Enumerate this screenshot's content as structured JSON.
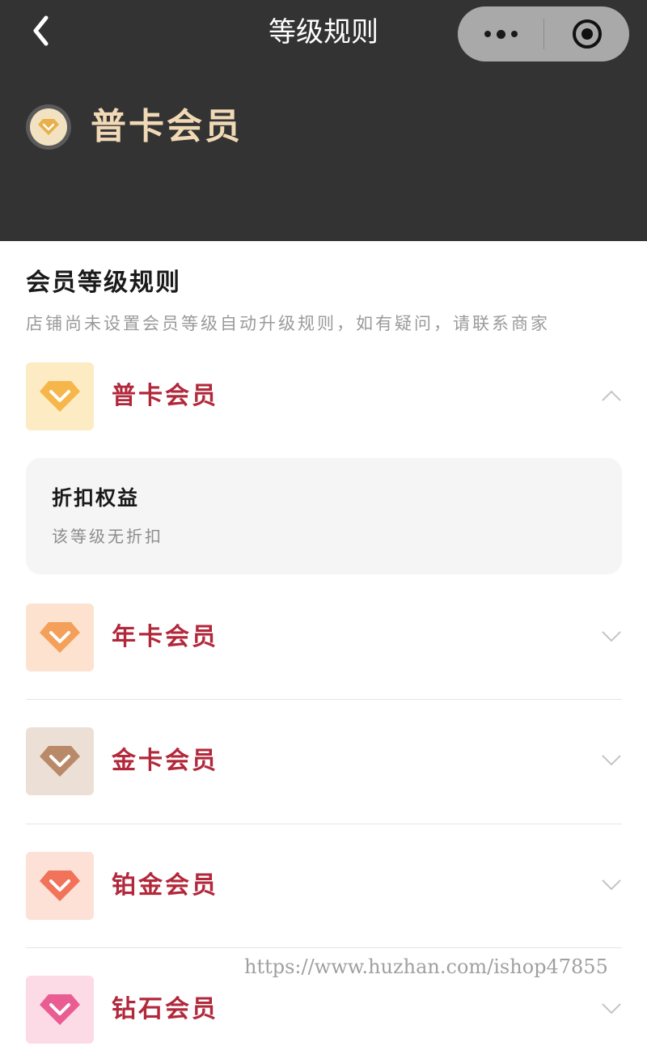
{
  "nav": {
    "title": "等级规则"
  },
  "current": {
    "level_name": "普卡会员"
  },
  "section": {
    "title": "会员等级规则",
    "description": "店铺尚未设置会员等级自动升级规则，如有疑问，请联系商家"
  },
  "levels": [
    {
      "name": "普卡会员",
      "expanded": true,
      "tile_color": "#fdebc4",
      "gem_color": "#f6b64a"
    },
    {
      "name": "年卡会员",
      "expanded": false,
      "tile_color": "#fde3cf",
      "gem_color": "#f4a05a"
    },
    {
      "name": "金卡会员",
      "expanded": false,
      "tile_color": "#ece0d6",
      "gem_color": "#b98a69"
    },
    {
      "name": "铂金会员",
      "expanded": false,
      "tile_color": "#fde0d6",
      "gem_color": "#f0735a"
    },
    {
      "name": "钻石会员",
      "expanded": false,
      "tile_color": "#fcdbe6",
      "gem_color": "#ea5d92"
    }
  ],
  "benefit": {
    "title": "折扣权益",
    "description": "该等级无折扣"
  },
  "watermark": "https://www.huzhan.com/ishop47855",
  "colors": {
    "header_bg": "#333333",
    "level_name": "#b2283b",
    "current_level_text": "#f1d9b6"
  }
}
